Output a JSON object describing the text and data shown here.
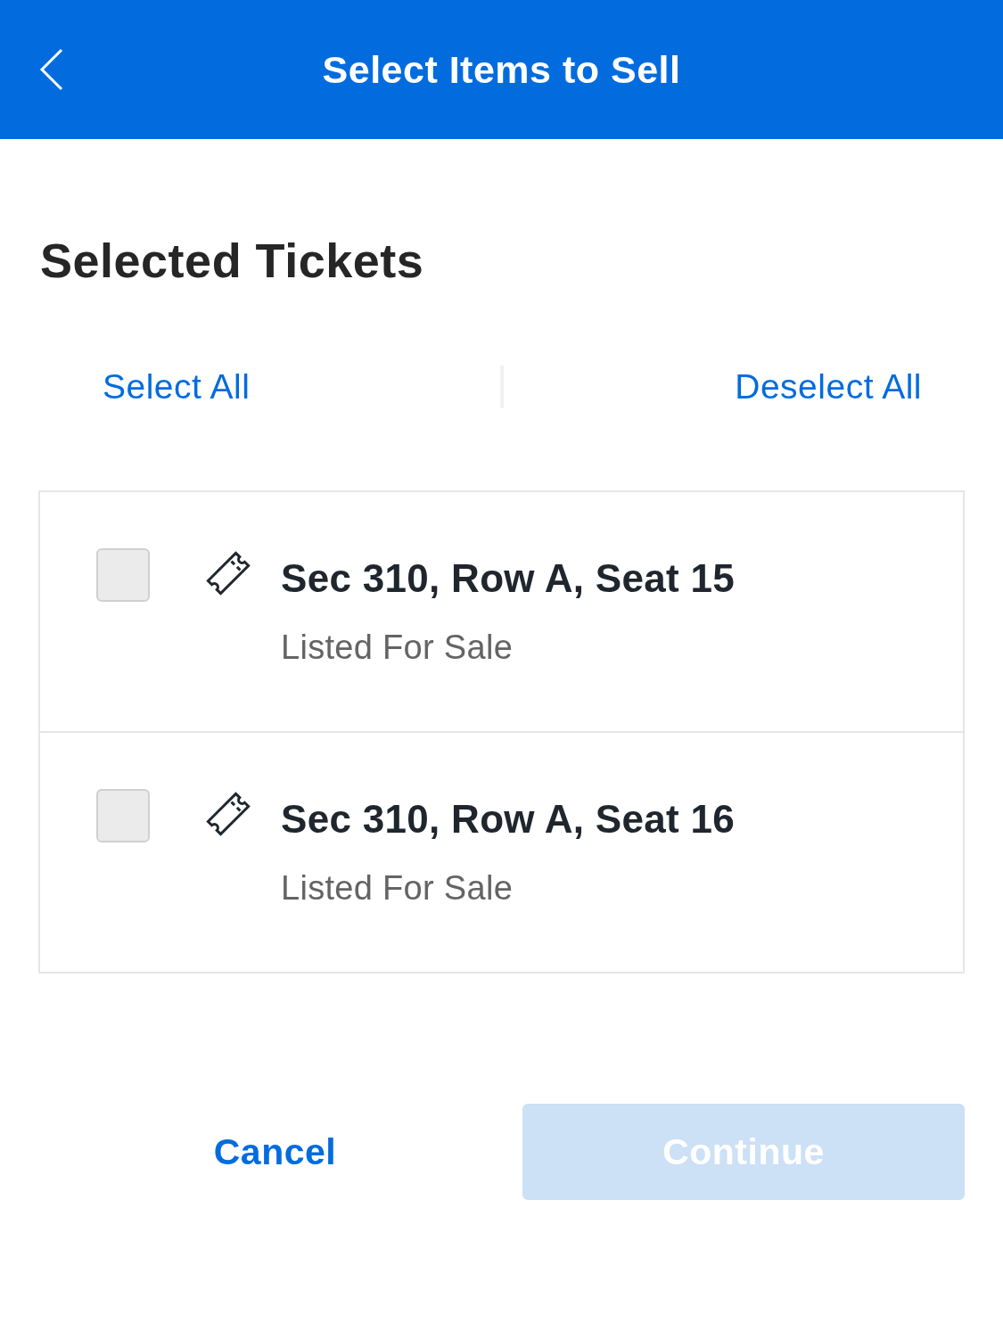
{
  "header": {
    "title": "Select Items to Sell"
  },
  "section": {
    "title": "Selected Tickets"
  },
  "bulk_actions": [
    {
      "label": "Select All"
    },
    {
      "label": "Deselect All"
    }
  ],
  "tickets": [
    {
      "title": "Sec 310, Row A, Seat 15",
      "status": "Listed For Sale",
      "checked": false
    },
    {
      "title": "Sec 310, Row A, Seat 16",
      "status": "Listed For Sale",
      "checked": false
    }
  ],
  "footer": {
    "cancel": {
      "label": "Cancel"
    },
    "continue": {
      "label": "Continue",
      "disabled": true
    }
  }
}
